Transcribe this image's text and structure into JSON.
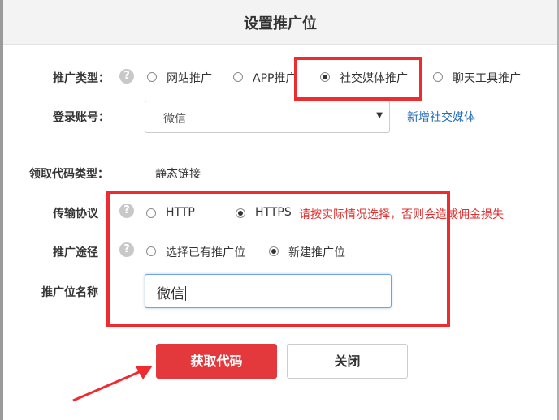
{
  "dialog": {
    "title": "设置推广位"
  },
  "promo_type": {
    "label": "推广类型：",
    "help_icon": "question-circle-icon",
    "options": [
      "网站推广",
      "APP推广",
      "社交媒体推广",
      "聊天工具推广"
    ],
    "selected": "社交媒体推广"
  },
  "account": {
    "label": "登录账号：",
    "selected": "微信",
    "add_link": "新增社交媒体"
  },
  "code_type": {
    "label": "领取代码类型：",
    "value": "静态链接"
  },
  "protocol": {
    "label": "传输协议",
    "options": [
      "HTTP",
      "HTTPS"
    ],
    "selected": "HTTPS",
    "warning": "请按实际情况选择，否则会造成佣金损失"
  },
  "channel": {
    "label": "推广途径",
    "options": [
      "选择已有推广位",
      "新建推广位"
    ],
    "selected": "新建推广位"
  },
  "promo_name": {
    "label": "推广位名称",
    "value": "微信"
  },
  "buttons": {
    "get_code": "获取代码",
    "close": "关闭"
  },
  "annotation": {
    "color": "#ee2b2f"
  }
}
